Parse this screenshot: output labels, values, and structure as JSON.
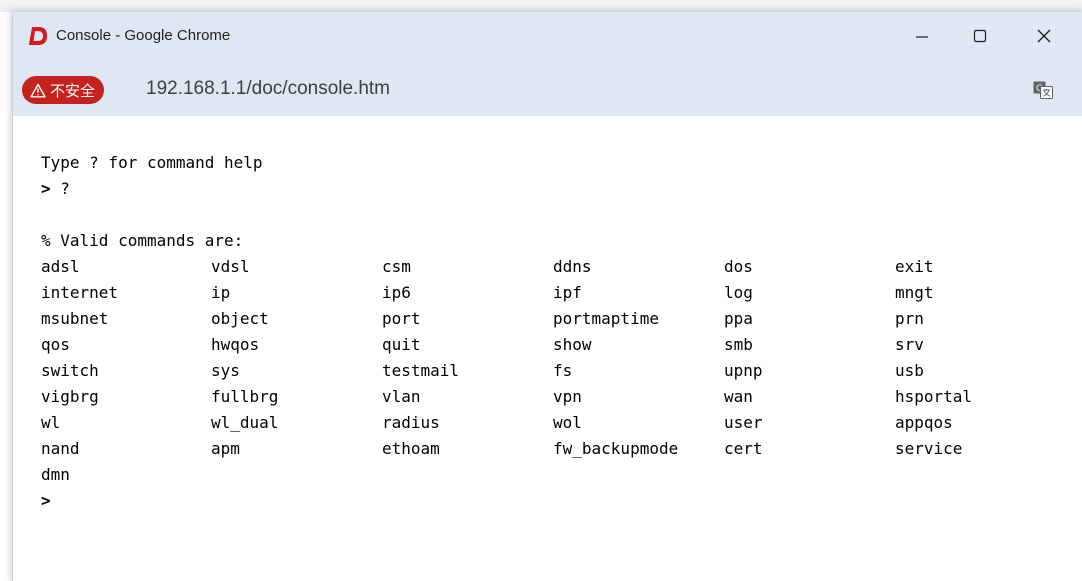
{
  "window": {
    "title": "Console - Google Chrome",
    "minimize_label": "—",
    "maximize_label": "☐",
    "close_label": "✕"
  },
  "address_bar": {
    "security_label": "不安全",
    "url": "192.168.1.1/doc/console.htm"
  },
  "console": {
    "help_line": "Type ? for command help",
    "prompt": ">",
    "typed_command": "?",
    "valid_header": "% Valid commands are:",
    "commands": [
      [
        "adsl",
        "vdsl",
        "csm",
        "ddns",
        "dos",
        "exit"
      ],
      [
        "internet",
        "ip",
        "ip6",
        "ipf",
        "log",
        "mngt"
      ],
      [
        "msubnet",
        "object",
        "port",
        "portmaptime",
        "ppa",
        "prn"
      ],
      [
        "qos",
        "hwqos",
        "quit",
        "show",
        "smb",
        "srv"
      ],
      [
        "switch",
        "sys",
        "testmail",
        "fs",
        "upnp",
        "usb"
      ],
      [
        "vigbrg",
        "fullbrg",
        "vlan",
        "vpn",
        "wan",
        "hsportal"
      ],
      [
        "wl",
        "wl_dual",
        "radius",
        "wol",
        "user",
        "appqos"
      ],
      [
        "nand",
        "apm",
        "ethoam",
        "fw_backupmode",
        "cert",
        "service"
      ],
      [
        "dmn",
        "",
        "",
        "",
        "",
        ""
      ]
    ]
  },
  "colors": {
    "titlebar": "#dfe7f2",
    "security_chip": "#c5221f",
    "app_logo": "#d9161c"
  },
  "icons": {
    "app_logo": "draytek-d-logo",
    "security": "warning-triangle-icon",
    "translate": "translate-icon"
  }
}
